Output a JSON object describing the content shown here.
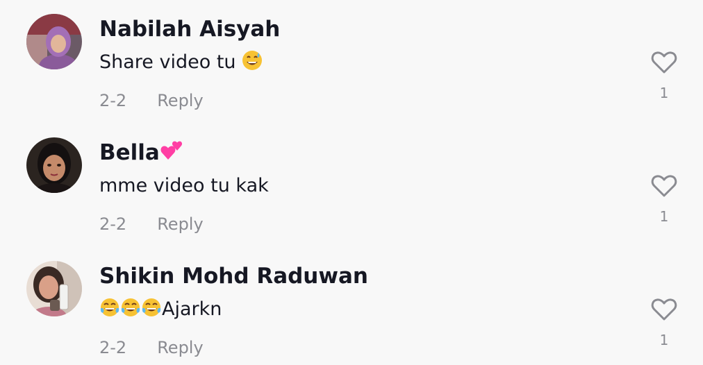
{
  "comments": [
    {
      "username": "Nabilah Aisyah",
      "username_emoji": "",
      "text": "Share video tu",
      "text_emoji_suffix": "sweat-smile-emoji",
      "date": "2-2",
      "reply_label": "Reply",
      "likes": "1"
    },
    {
      "username": "Bella",
      "username_emoji": "two-hearts-emoji",
      "text": "mme video tu kak",
      "date": "2-2",
      "reply_label": "Reply",
      "likes": "1"
    },
    {
      "username": "Shikin Mohd Raduwan",
      "username_emoji": "",
      "text_emoji_prefix": "tears-of-joy-emoji x3",
      "text": "Ajarkn",
      "date": "2-2",
      "reply_label": "Reply",
      "likes": "1"
    }
  ],
  "colors": {
    "background": "#f8f8f8",
    "primary_text": "#161823",
    "secondary_text": "#8a8b91",
    "heart_outline": "#8a8b91"
  }
}
